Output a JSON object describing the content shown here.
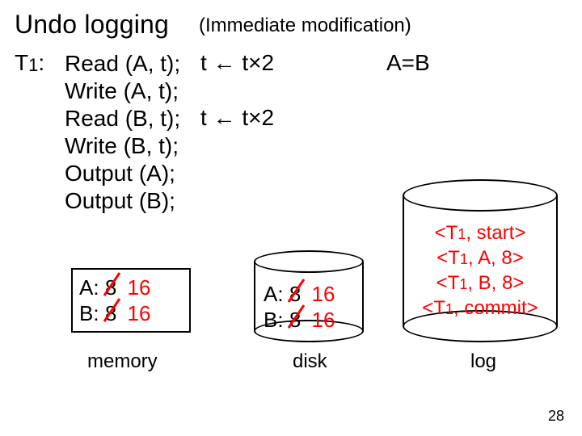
{
  "title": "Undo logging",
  "subtitle": "(Immediate modification)",
  "tx_label_prefix": "T",
  "tx_label_sub": "1",
  "tx_label_suffix": ":",
  "code": {
    "l1": "Read (A, t);",
    "l2": "Write (A, t);",
    "l3": "Read (B, t);",
    "l4": "Write (B, t);",
    "l5": "Output (A);",
    "l6": "Output (B);"
  },
  "assign1": "t ← t×2",
  "assign2": "t ← t×2",
  "aeqb": "A=B",
  "memory": {
    "a_label": "A:",
    "a_old": "8",
    "a_new": "16",
    "b_label": "B:",
    "b_old": "8",
    "b_new": "16",
    "caption": "memory"
  },
  "disk": {
    "a_label": "A:",
    "a_old": "8",
    "a_new": "16",
    "b_label": "B:",
    "b_old": "8",
    "b_new": "16",
    "caption": "disk"
  },
  "log": {
    "l1_a": "<T",
    "l1_b": "1",
    "l1_c": ", start>",
    "l2_a": "<T",
    "l2_b": "1",
    "l2_c": ", A, 8>",
    "l3_a": "<T",
    "l3_b": "1",
    "l3_c": ", B, 8>",
    "l4_a": "<T",
    "l4_b": "1",
    "l4_c": ", commit>",
    "caption": "log"
  },
  "page_number": "28"
}
